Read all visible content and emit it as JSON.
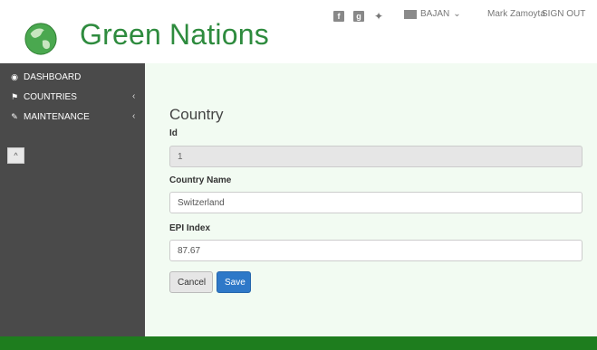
{
  "brand": {
    "name": "Green Nations"
  },
  "header": {
    "language": "BAJAN",
    "user_name": "Mark Zamoyta",
    "signout_label": "SIGN OUT",
    "social": [
      "facebook-icon",
      "google-plus-icon",
      "twitter-icon"
    ]
  },
  "sidebar": {
    "items": [
      {
        "label": "DASHBOARD",
        "icon": "dashboard-icon"
      },
      {
        "label": "COUNTRIES",
        "icon": "flag-icon",
        "chevron": "‹"
      },
      {
        "label": "MAINTENANCE",
        "icon": "wrench-icon",
        "chevron": "‹"
      }
    ],
    "collapse_label": "^"
  },
  "form": {
    "title": "Country",
    "id_label": "Id",
    "id_value": "1",
    "name_label": "Country Name",
    "name_value": "Switzerland",
    "epi_label": "EPI Index",
    "epi_value": "87.67",
    "cancel_label": "Cancel",
    "save_label": "Save"
  },
  "colors": {
    "brand_green": "#2e8b3e",
    "sidebar_bg": "#4a4a4a",
    "main_bg": "#f2fbf2",
    "save_blue": "#2e78c8",
    "footer_green": "#1e7d1e"
  }
}
